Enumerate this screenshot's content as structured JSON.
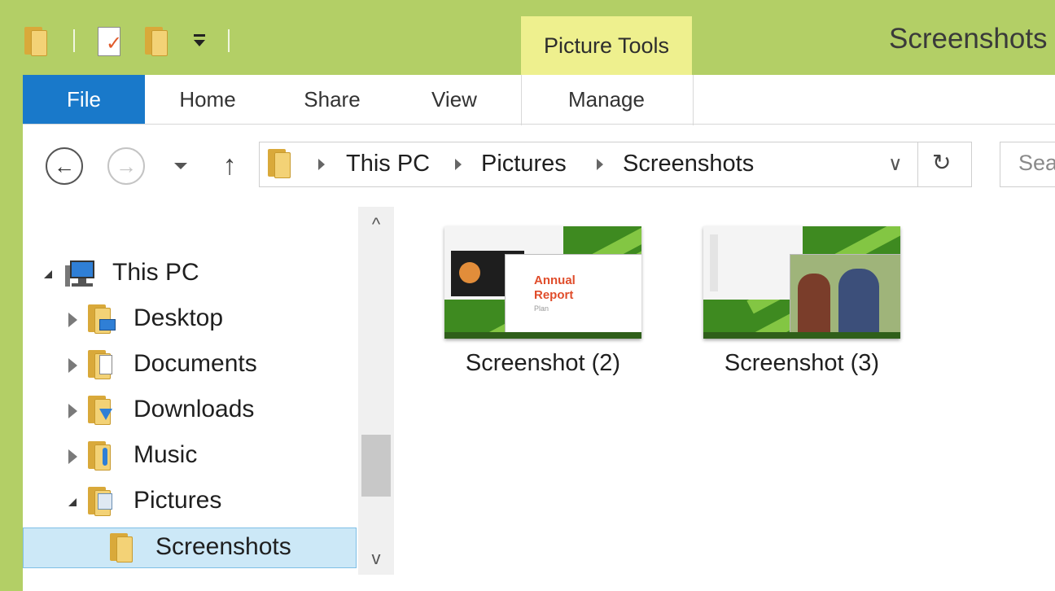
{
  "window": {
    "title": "Screenshots",
    "context_tab_group": "Picture Tools"
  },
  "colors": {
    "frame": "#b3cf66",
    "file_tab": "#1979ca",
    "context_highlight": "#eef08e",
    "selection": "#cce8f7"
  },
  "quick_access": {
    "icons": [
      "folder-icon",
      "properties-icon",
      "new-folder-icon",
      "customize-dropdown-icon"
    ]
  },
  "ribbon": {
    "file_label": "File",
    "tabs": [
      {
        "label": "Home"
      },
      {
        "label": "Share"
      },
      {
        "label": "View"
      },
      {
        "label": "Manage"
      }
    ]
  },
  "navigation": {
    "back_glyph": "←",
    "forward_glyph": "→",
    "up_glyph": "↑",
    "refresh_glyph": "↻",
    "dropdown_glyph": "∨",
    "breadcrumb": [
      "This PC",
      "Pictures",
      "Screenshots"
    ],
    "search_placeholder": "Search Screenshots"
  },
  "tree": {
    "items": [
      {
        "label": "This PC",
        "state": "expanded",
        "icon": "computer-icon"
      },
      {
        "label": "Desktop",
        "state": "collapsed",
        "icon": "desktop-folder-icon"
      },
      {
        "label": "Documents",
        "state": "collapsed",
        "icon": "documents-folder-icon"
      },
      {
        "label": "Downloads",
        "state": "collapsed",
        "icon": "downloads-folder-icon"
      },
      {
        "label": "Music",
        "state": "collapsed",
        "icon": "music-folder-icon"
      },
      {
        "label": "Pictures",
        "state": "expanded",
        "icon": "pictures-folder-icon"
      },
      {
        "label": "Screenshots",
        "state": "selected",
        "icon": "folder-icon"
      }
    ]
  },
  "scrollbar": {
    "up_glyph": "^",
    "down_glyph": "v"
  },
  "files": [
    {
      "name": "Screenshot (2)",
      "preview_text": "Annual Report",
      "preview_sub": "Plan"
    },
    {
      "name": "Screenshot (3)"
    }
  ]
}
